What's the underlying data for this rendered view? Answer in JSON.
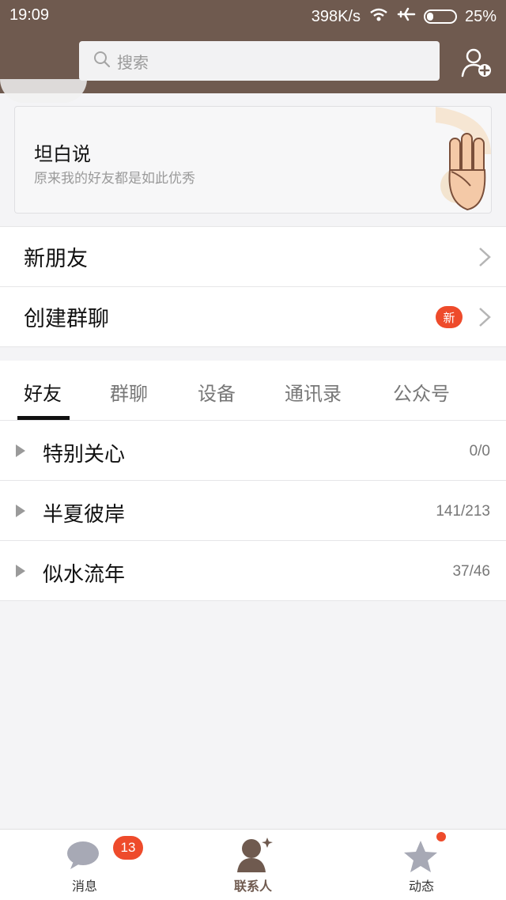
{
  "status": {
    "time": "19:09",
    "speed": "398K/s",
    "battery": "25%"
  },
  "search": {
    "placeholder": "搜索"
  },
  "banner": {
    "title": "坦白说",
    "subtitle": "原来我的好友都是如此优秀"
  },
  "menu": {
    "new_friends": "新朋友",
    "create_group": "创建群聊",
    "new_badge": "新"
  },
  "tabs": [
    "好友",
    "群聊",
    "设备",
    "通讯录",
    "公众号"
  ],
  "groups": [
    {
      "name": "特别关心",
      "count": "0/0"
    },
    {
      "name": "半夏彼岸",
      "count": "141/213"
    },
    {
      "name": "似水流年",
      "count": "37/46"
    }
  ],
  "bottom_nav": {
    "messages": {
      "label": "消息",
      "badge": "13"
    },
    "contacts": {
      "label": "联系人"
    },
    "dynamics": {
      "label": "动态"
    }
  },
  "colors": {
    "header": "#6f5a4f",
    "badge": "#ee4b2b"
  },
  "icons": [
    "search-icon",
    "add-contact-icon",
    "wifi-icon",
    "airplane-icon",
    "battery-icon",
    "chevron-right-icon",
    "expand-triangle-icon",
    "chat-bubble-icon",
    "contacts-person-icon",
    "star-icon",
    "hand-gesture-icon"
  ]
}
